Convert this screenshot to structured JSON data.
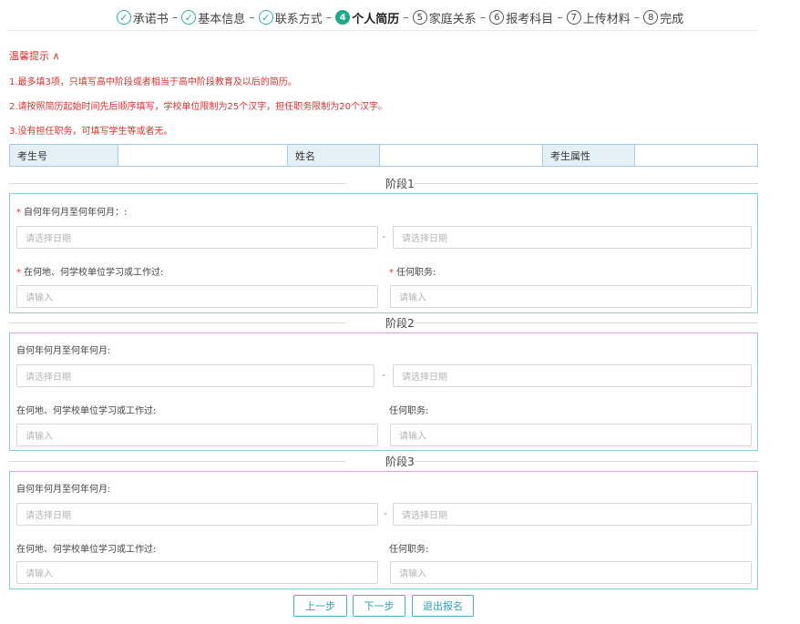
{
  "steps": [
    {
      "label": "承诺书",
      "mark": "✓",
      "state": "done"
    },
    {
      "label": "基本信息",
      "mark": "✓",
      "state": "done"
    },
    {
      "label": "联系方式",
      "mark": "✓",
      "state": "done"
    },
    {
      "label": "个人简历",
      "mark": "4",
      "state": "active"
    },
    {
      "label": "家庭关系",
      "mark": "5",
      "state": "todo"
    },
    {
      "label": "报考科目",
      "mark": "6",
      "state": "todo"
    },
    {
      "label": "上传材料",
      "mark": "7",
      "state": "todo"
    },
    {
      "label": "完成",
      "mark": "8",
      "state": "todo"
    }
  ],
  "tips": {
    "title": "温馨提示 ∧",
    "items": [
      "1.最多填3项，只填写高中阶段或者相当于高中阶段教育及以后的简历。",
      "2.请按照简历起始时间先后顺序填写，学校单位限制为25个汉字，担任职务限制为20个汉字。",
      "3.没有担任职务，可填写学生等或者无。"
    ]
  },
  "info": {
    "exam_no_label": "考生号",
    "exam_no_value": "",
    "name_label": "姓名",
    "name_value": "",
    "attr_label": "考生属性",
    "attr_value": ""
  },
  "stages": [
    {
      "title": "阶段1",
      "date_label": "自何年何月至何年何月：:",
      "date_start_placeholder": "请选择日期",
      "date_end_placeholder": "请选择日期",
      "dash": "-",
      "place_label": "在何地、何学校单位学习或工作过:",
      "place_placeholder": "请输入",
      "position_label": "任何职务:",
      "position_placeholder": "请输入",
      "required": true
    },
    {
      "title": "阶段2",
      "date_label": "自何年何月至何年何月:",
      "date_start_placeholder": "请选择日期",
      "date_end_placeholder": "请选择日期",
      "dash": "-",
      "place_label": "在何地、何学校单位学习或工作过:",
      "place_placeholder": "请输入",
      "position_label": "任何职务:",
      "position_placeholder": "请输入",
      "required": false
    },
    {
      "title": "阶段3",
      "date_label": "自何年何月至何年何月:",
      "date_start_placeholder": "请选择日期",
      "date_end_placeholder": "请选择日期",
      "dash": "-",
      "place_label": "在何地、何学校单位学习或工作过:",
      "place_placeholder": "请输入",
      "position_label": "任何职务:",
      "position_placeholder": "请输入",
      "required": false
    }
  ],
  "buttons": {
    "prev": "上一步",
    "next": "下一步",
    "exit": "退出报名"
  },
  "colors": {
    "accent": "#1fa88a",
    "warning": "#e0302f",
    "border": "#8fcbe4",
    "button_text": "#2aa0b8"
  }
}
